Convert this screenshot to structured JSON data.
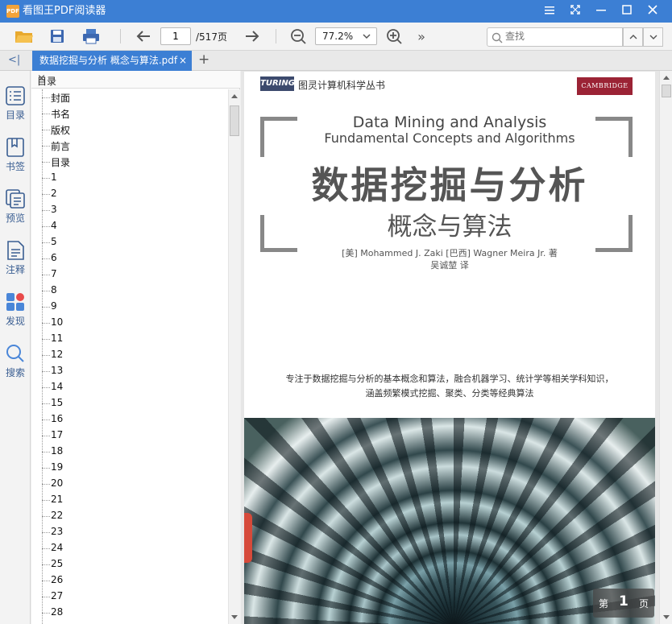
{
  "window": {
    "app_title": "看图王PDF阅读器",
    "logo_text": "PDF",
    "controls": [
      "menu",
      "fullscreen",
      "minimize",
      "maximize",
      "close"
    ]
  },
  "toolbar": {
    "current_page": "1",
    "total_pages": "/517页",
    "zoom": "77.2%",
    "search_placeholder": "查找",
    "more": "»"
  },
  "tabs": {
    "active_tab": "数据挖掘与分析  概念与算法.pdf",
    "close_glyph": "×",
    "new_tab_glyph": "+",
    "collapse_glyph": "<|"
  },
  "left_rail": {
    "items": [
      {
        "label": "目录",
        "icon": "toc-icon"
      },
      {
        "label": "书签",
        "icon": "bookmark-icon"
      },
      {
        "label": "预览",
        "icon": "preview-icon"
      },
      {
        "label": "注释",
        "icon": "annotation-icon"
      },
      {
        "label": "发现",
        "icon": "discover-icon"
      },
      {
        "label": "搜索",
        "icon": "search-icon"
      }
    ]
  },
  "toc": {
    "header": "目录",
    "close_glyph": "×",
    "items": [
      "封面",
      "书名",
      "版权",
      "前言",
      "目录",
      "1",
      "2",
      "3",
      "4",
      "5",
      "6",
      "7",
      "8",
      "9",
      "10",
      "11",
      "12",
      "13",
      "14",
      "15",
      "16",
      "17",
      "18",
      "19",
      "20",
      "21",
      "22",
      "23",
      "24",
      "25",
      "26",
      "27",
      "28"
    ]
  },
  "pdf_page": {
    "publisher_logo": "TURING",
    "series": "图灵计算机科学丛书",
    "cambridge": "CAMBRIDGE",
    "en_title_1": "Data Mining and Analysis",
    "en_title_2": "Fundamental Concepts and Algorithms",
    "cn_title": "数据挖掘与分析",
    "cn_subtitle": "概念与算法",
    "authors": "[美] Mohammed J. Zaki   [巴西] Wagner Meira Jr. 著",
    "translator": "吴诚堃 译",
    "blurb_line1": "专注于数据挖掘与分析的基本概念和算法，融合机器学习、统计学等相关学科知识，",
    "blurb_line2": "涵盖频繁模式挖掘、聚类、分类等经典算法"
  },
  "page_badge": {
    "prefix": "第",
    "number": "1",
    "suffix": "页"
  }
}
